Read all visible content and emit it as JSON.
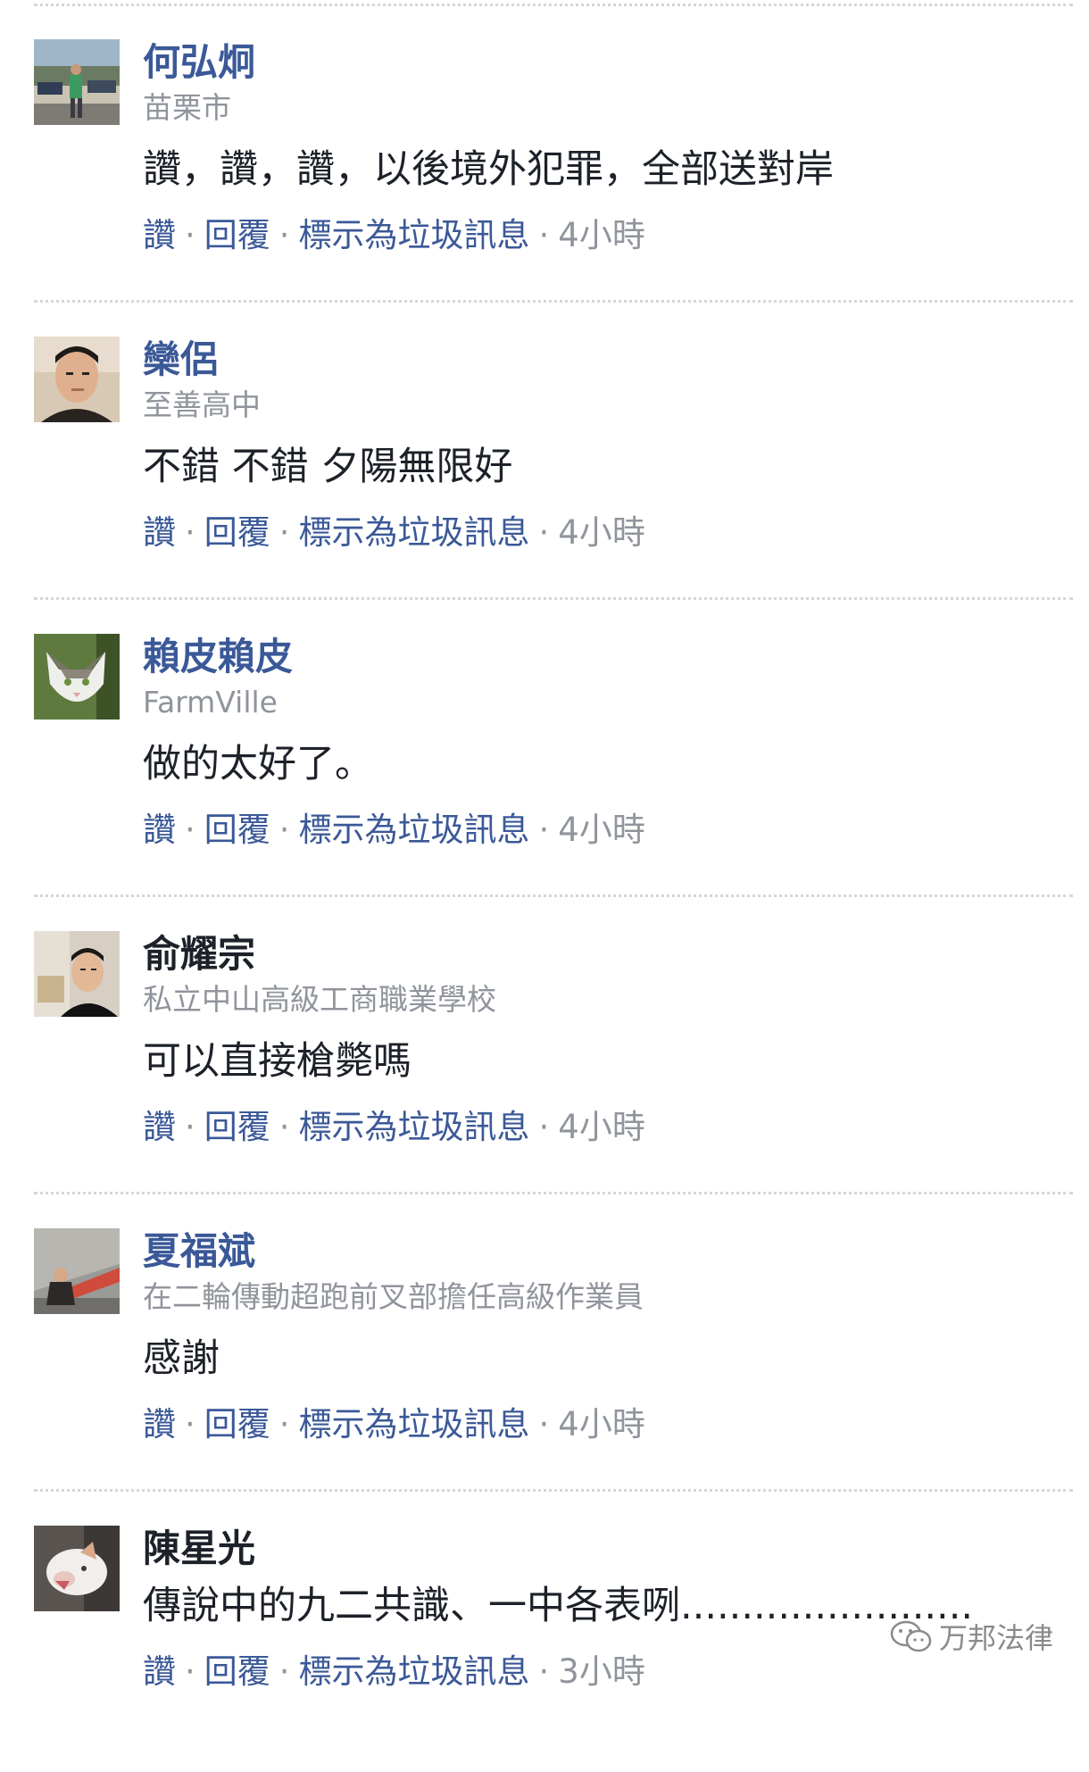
{
  "comments": [
    {
      "name": "何弘炯",
      "subtitle": "苗栗市",
      "text": "讚，讚，讚，以後境外犯罪，全部送對岸",
      "like": "讚",
      "reply": "回覆",
      "mark_spam": "標示為垃圾訊息",
      "time": "4小時"
    },
    {
      "name": "欒侶",
      "subtitle": "至善高中",
      "text": "不錯 不錯 夕陽無限好",
      "like": "讚",
      "reply": "回覆",
      "mark_spam": "標示為垃圾訊息",
      "time": "4小時"
    },
    {
      "name": "賴皮賴皮",
      "subtitle": "FarmVille",
      "text": "做的太好了。",
      "like": "讚",
      "reply": "回覆",
      "mark_spam": "標示為垃圾訊息",
      "time": "4小時"
    },
    {
      "name": "俞耀宗",
      "subtitle": "私立中山高級工商職業學校",
      "text": "可以直接槍斃嗎",
      "like": "讚",
      "reply": "回覆",
      "mark_spam": "標示為垃圾訊息",
      "time": "4小時"
    },
    {
      "name": "夏福斌",
      "subtitle": "在二輪傳動超跑前叉部擔任高級作業員",
      "text": "感謝",
      "like": "讚",
      "reply": "回覆",
      "mark_spam": "標示為垃圾訊息",
      "time": "4小時"
    },
    {
      "name": "陳星光",
      "subtitle": "",
      "text": "傳說中的九二共識、一中各表咧........................",
      "like": "讚",
      "reply": "回覆",
      "mark_spam": "標示為垃圾訊息",
      "time": "3小時"
    }
  ],
  "separator": "·",
  "watermark": "万邦法律",
  "colors": {
    "link": "#3b5998",
    "meta": "#90949c",
    "text": "#1d2129",
    "divider": "#d3d6db"
  }
}
